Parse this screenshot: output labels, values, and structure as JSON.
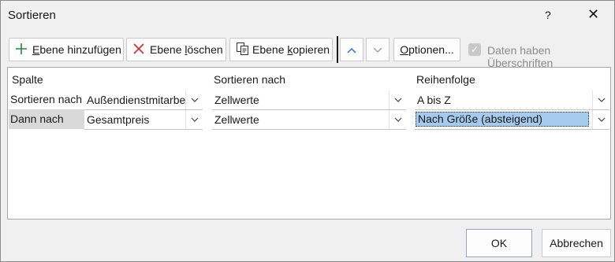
{
  "dialog": {
    "title": "Sortieren",
    "help": "?",
    "close": "✕"
  },
  "toolbar": {
    "add_level": {
      "prefix": "",
      "mnemonic": "E",
      "rest": "bene hinzufügen"
    },
    "delete_level": {
      "prefix": "Ebene ",
      "mnemonic": "l",
      "rest": "öschen"
    },
    "copy_level": {
      "prefix": "Ebene ",
      "mnemonic": "k",
      "rest": "opieren"
    },
    "options": {
      "prefix": "",
      "mnemonic": "O",
      "rest": "ptionen..."
    },
    "headers_checkbox": {
      "checked": true,
      "label_prefix": "Daten haben Übersc",
      "mnemonic": "h",
      "label_rest": "riften"
    }
  },
  "grid": {
    "headers": {
      "column": "Spalte",
      "sort_on": "Sortieren nach",
      "order": "Reihenfolge"
    },
    "rows": [
      {
        "label": "Sortieren nach",
        "column": "Außendienstmitarbeiter",
        "sort_on": "Zellwerte",
        "order": "A bis Z",
        "selected": false
      },
      {
        "label": "Dann nach",
        "column": "Gesamtpreis",
        "sort_on": "Zellwerte",
        "order": "Nach Größe (absteigend)",
        "selected": true
      }
    ]
  },
  "footer": {
    "ok": "OK",
    "cancel": "Abbrechen"
  },
  "colors": {
    "accent_blue": "#2f6fd1",
    "highlight": "#a4cbed",
    "delete_red": "#d9262b",
    "add_green": "#1f8c3b"
  }
}
